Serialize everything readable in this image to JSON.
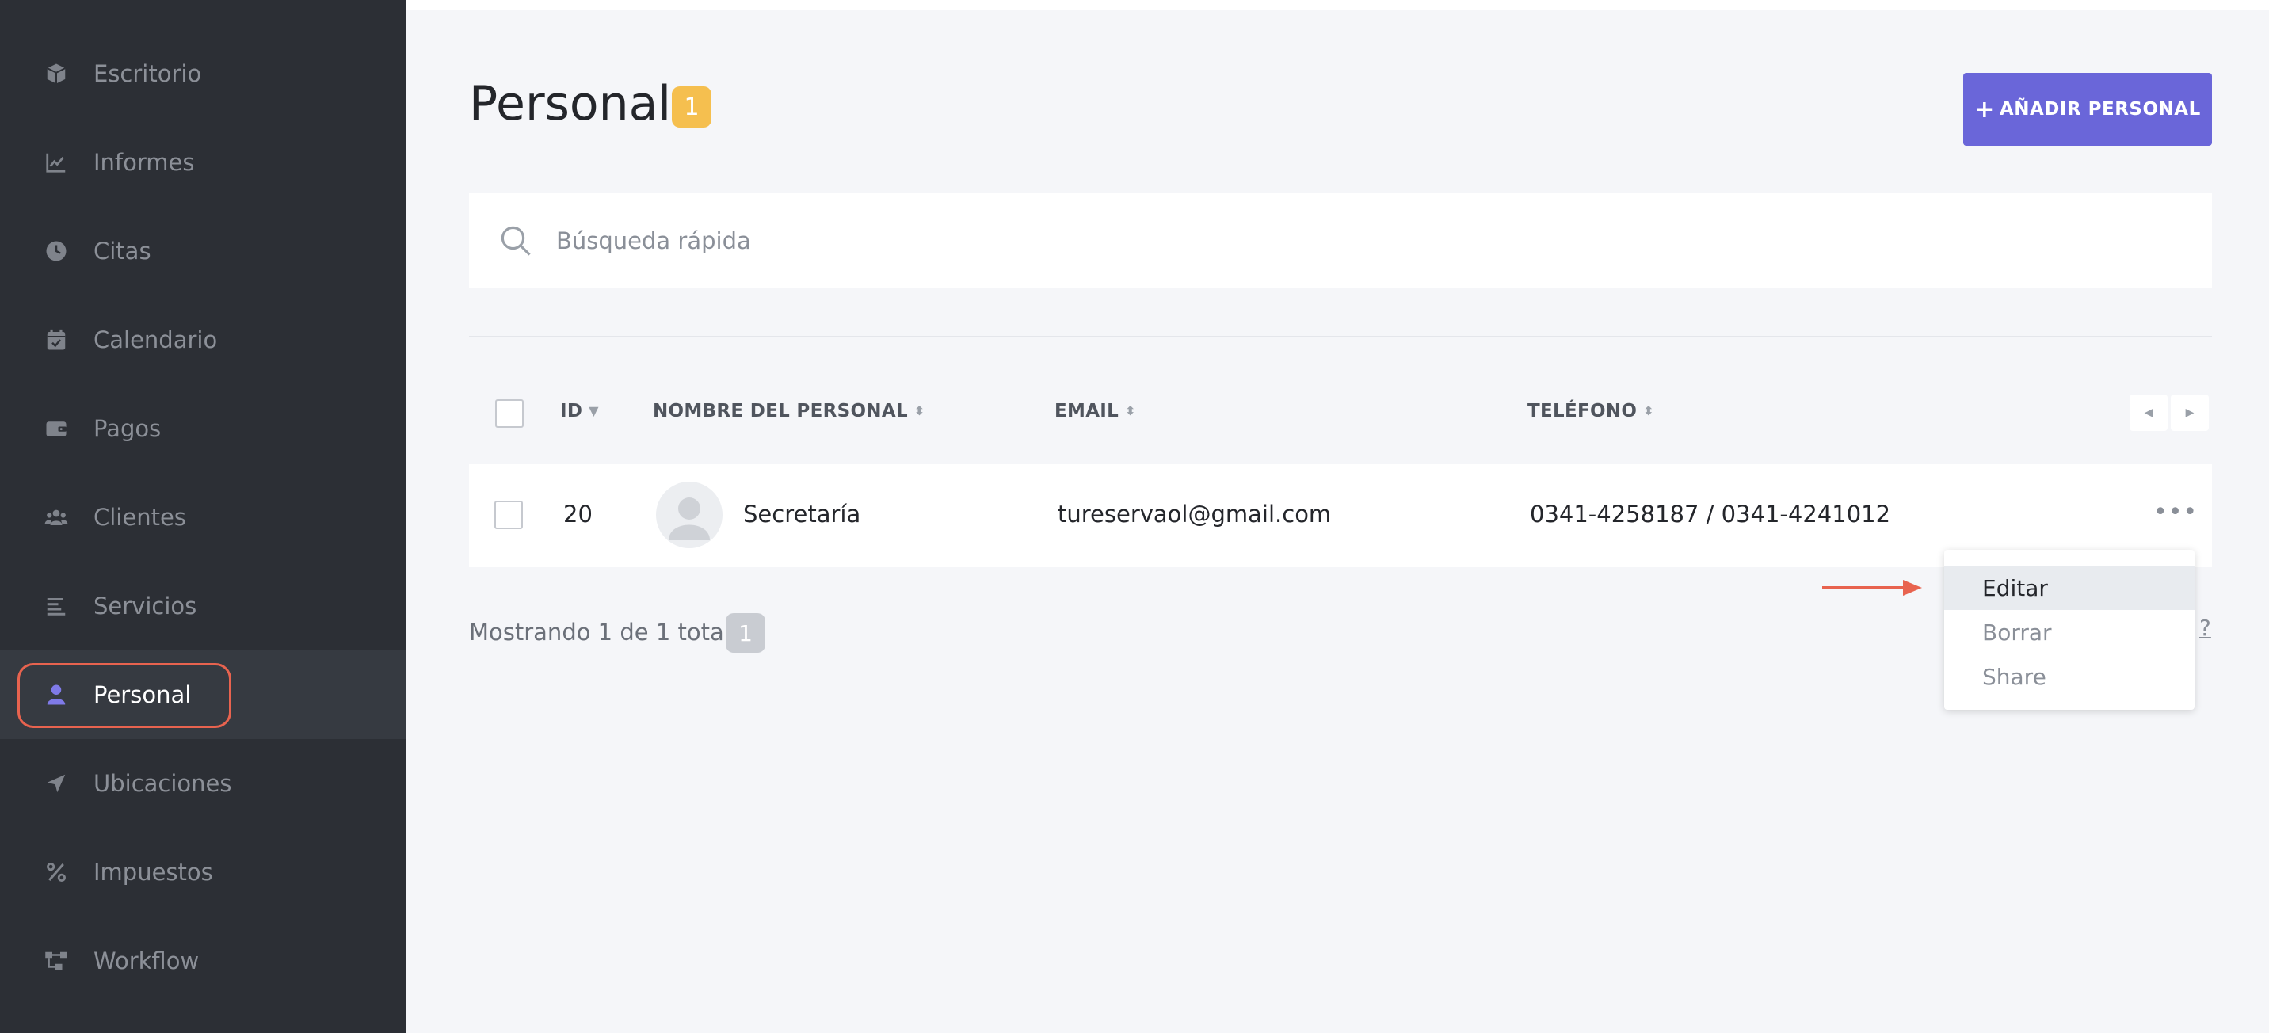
{
  "sidebar": {
    "items": [
      {
        "label": "Escritorio",
        "icon": "box-icon"
      },
      {
        "label": "Informes",
        "icon": "chart-line-icon"
      },
      {
        "label": "Citas",
        "icon": "clock-icon"
      },
      {
        "label": "Calendario",
        "icon": "calendar-check-icon"
      },
      {
        "label": "Pagos",
        "icon": "wallet-icon"
      },
      {
        "label": "Clientes",
        "icon": "users-icon"
      },
      {
        "label": "Servicios",
        "icon": "list-icon"
      },
      {
        "label": "Personal",
        "icon": "user-icon",
        "active": true
      },
      {
        "label": "Ubicaciones",
        "icon": "location-arrow-icon"
      },
      {
        "label": "Impuestos",
        "icon": "percent-icon"
      },
      {
        "label": "Workflow",
        "icon": "workflow-icon"
      }
    ]
  },
  "header": {
    "title": "Personal",
    "count": "1",
    "add_button_label": "AÑADIR PERSONAL"
  },
  "search": {
    "placeholder": "Búsqueda rápida",
    "value": ""
  },
  "table": {
    "columns": {
      "id": "ID",
      "name": "NOMBRE DEL PERSONAL",
      "email": "EMAIL",
      "phone": "TELÉFONO"
    },
    "rows": [
      {
        "id": "20",
        "name": "Secretaría",
        "email": "tureservaol@gmail.com",
        "phone": "0341-4258187 / 0341-4241012"
      }
    ]
  },
  "footer": {
    "showing_text": "Mostrando 1 de 1 total",
    "page": "1",
    "help_text": "?"
  },
  "row_menu": {
    "items": [
      "Editar",
      "Borrar",
      "Share"
    ],
    "highlighted": "Editar"
  },
  "colors": {
    "sidebar_bg": "#2c2f35",
    "accent": "#6a66d9",
    "badge": "#f5bf4f",
    "annotation": "#e8634f"
  }
}
